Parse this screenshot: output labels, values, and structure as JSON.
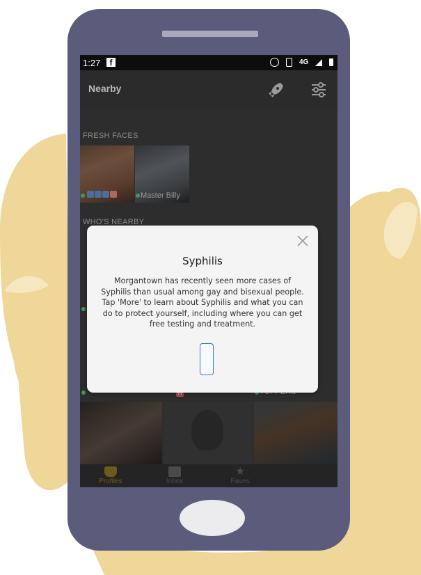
{
  "colors": {
    "hand": "#efd699",
    "hand_highlight": "#f6e7c0",
    "phone_body": "#5b5b7b",
    "app_background": "#2d2d2d",
    "accent_yellow": "#f0b92f",
    "online_green": "#3b9a55",
    "dialog_button_blue": "#2d7cc8"
  },
  "statusbar": {
    "time": "1:27",
    "facebook_badge": "f",
    "network": "4G",
    "icons": [
      "alarm-icon",
      "vibrate-icon",
      "network-icon",
      "signal-icon",
      "battery-icon"
    ]
  },
  "appbar": {
    "title": "Nearby",
    "icons": [
      "rocket-icon",
      "filter-icon"
    ]
  },
  "sections": {
    "fresh_faces_label": "FRESH FACES",
    "whos_nearby_label": "WHO'S NEARBY"
  },
  "fresh_faces": [
    {
      "name": ""
    },
    {
      "name": "Master Billy"
    }
  ],
  "grid": {
    "partial_name": "TOPPERS"
  },
  "dialog": {
    "title": "Syphilis",
    "body": "Morgantown has recently seen more cases of Syphilis than usual among gay and bisexual people. Tap 'More' to learn about Syphilis and what you can do to protect yourself, including where you can get free testing and treatment.",
    "button_label": ""
  },
  "bottom_nav": [
    {
      "label": "Profiles",
      "icon": "mask-icon"
    },
    {
      "label": "Inbox",
      "icon": "chat-icon"
    },
    {
      "label": "Faves",
      "icon": "star-icon"
    }
  ]
}
